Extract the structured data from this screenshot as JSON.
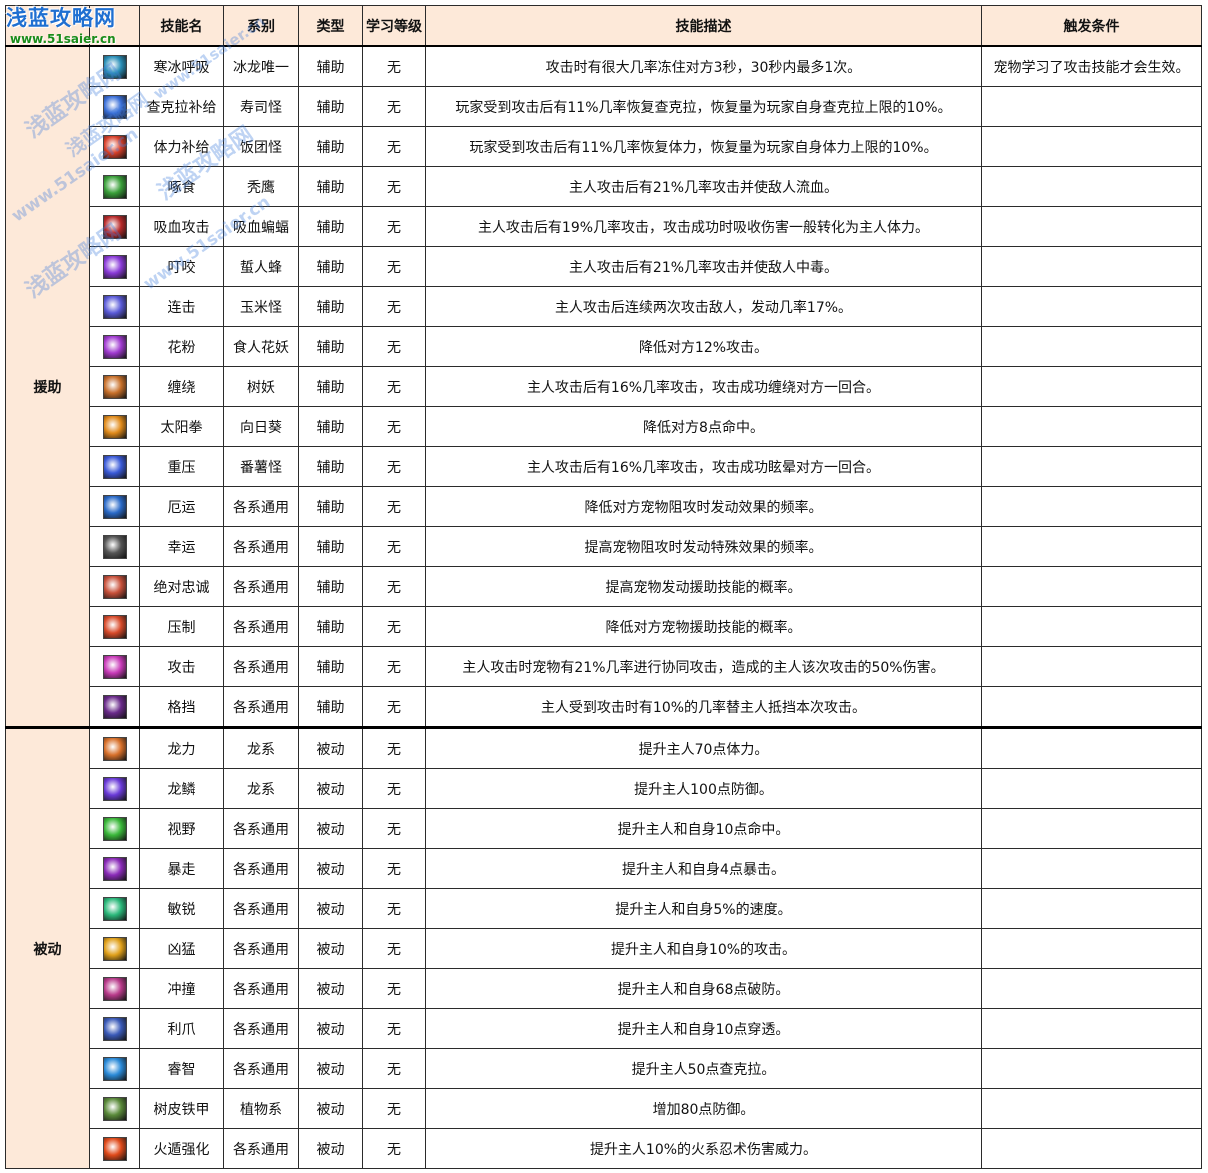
{
  "logo": {
    "line1": "浅蓝攻略网",
    "line2": "www.51saier.cn"
  },
  "watermarks": [
    "浅蓝攻略网",
    "www.51saier.cn",
    "浅蓝攻略网",
    "www.51saier.cn",
    "浅蓝攻略网",
    "www.51saier.cn",
    "浅蓝攻略网"
  ],
  "headers": {
    "icon": "",
    "name": "技能名",
    "series": "系别",
    "type": "类型",
    "level": "学习等级",
    "desc": "技能描述",
    "trigger": "触发条件"
  },
  "groups": [
    {
      "category": "援助",
      "rows": [
        {
          "icon": "ice-breath-icon",
          "color": "#2a8fb8",
          "name": "寒冰呼吸",
          "series": "冰龙唯一",
          "type": "辅助",
          "level": "无",
          "desc": "攻击时有很大几率冻住对方3秒，30秒内最多1次。",
          "trigger": "宠物学习了攻击技能才会生效。"
        },
        {
          "icon": "chakra-supply-icon",
          "color": "#3a6fd8",
          "name": "查克拉补给",
          "series": "寿司怪",
          "type": "辅助",
          "level": "无",
          "desc": "玩家受到攻击后有11%几率恢复查克拉，恢复量为玩家自身查克拉上限的10%。",
          "trigger": ""
        },
        {
          "icon": "stamina-supply-icon",
          "color": "#d8402a",
          "name": "体力补给",
          "series": "饭团怪",
          "type": "辅助",
          "level": "无",
          "desc": "玩家受到攻击后有11%几率恢复体力，恢复量为玩家自身体力上限的10%。",
          "trigger": ""
        },
        {
          "icon": "peck-icon",
          "color": "#3aa03a",
          "name": "啄食",
          "series": "秃鹰",
          "type": "辅助",
          "level": "无",
          "desc": "主人攻击后有21%几率攻击并使敌人流血。",
          "trigger": ""
        },
        {
          "icon": "vampire-attack-icon",
          "color": "#b82a2a",
          "name": "吸血攻击",
          "series": "吸血蝙蝠",
          "type": "辅助",
          "level": "无",
          "desc": "主人攻击后有19%几率攻击，攻击成功时吸收伤害一般转化为主人体力。",
          "trigger": ""
        },
        {
          "icon": "sting-icon",
          "color": "#8a3ad8",
          "name": "叮咬",
          "series": "蜇人蜂",
          "type": "辅助",
          "level": "无",
          "desc": "主人攻击后有21%几率攻击并使敌人中毒。",
          "trigger": ""
        },
        {
          "icon": "combo-icon",
          "color": "#5a5ad8",
          "name": "连击",
          "series": "玉米怪",
          "type": "辅助",
          "level": "无",
          "desc": "主人攻击后连续两次攻击敌人，发动几率17%。",
          "trigger": ""
        },
        {
          "icon": "pollen-icon",
          "color": "#a03ad0",
          "name": "花粉",
          "series": "食人花妖",
          "type": "辅助",
          "level": "无",
          "desc": "降低对方12%攻击。",
          "trigger": ""
        },
        {
          "icon": "entangle-icon",
          "color": "#c8702a",
          "name": "缠绕",
          "series": "树妖",
          "type": "辅助",
          "level": "无",
          "desc": "主人攻击后有16%几率攻击，攻击成功缠绕对方一回合。",
          "trigger": ""
        },
        {
          "icon": "sun-fist-icon",
          "color": "#e08a1a",
          "name": "太阳拳",
          "series": "向日葵",
          "type": "辅助",
          "level": "无",
          "desc": "降低对方8点命中。",
          "trigger": ""
        },
        {
          "icon": "heavy-press-icon",
          "color": "#3a5ad8",
          "name": "重压",
          "series": "番薯怪",
          "type": "辅助",
          "level": "无",
          "desc": "主人攻击后有16%几率攻击，攻击成功眩晕对方一回合。",
          "trigger": ""
        },
        {
          "icon": "bad-luck-icon",
          "color": "#2a6ac8",
          "name": "厄运",
          "series": "各系通用",
          "type": "辅助",
          "level": "无",
          "desc": "降低对方宠物阻攻时发动效果的频率。",
          "trigger": ""
        },
        {
          "icon": "lucky-clover-icon",
          "color": "#555555",
          "name": "幸运",
          "series": "各系通用",
          "type": "辅助",
          "level": "无",
          "desc": "提高宠物阻攻时发动特殊效果的频率。",
          "trigger": ""
        },
        {
          "icon": "absolute-loyalty-icon",
          "color": "#c8503a",
          "name": "绝对忠诚",
          "series": "各系通用",
          "type": "辅助",
          "level": "无",
          "desc": "提高宠物发动援助技能的概率。",
          "trigger": ""
        },
        {
          "icon": "suppress-icon",
          "color": "#d84a2a",
          "name": "压制",
          "series": "各系通用",
          "type": "辅助",
          "level": "无",
          "desc": "降低对方宠物援助技能的概率。",
          "trigger": ""
        },
        {
          "icon": "attack-slash-icon",
          "color": "#c83ab8",
          "name": "攻击",
          "series": "各系通用",
          "type": "辅助",
          "level": "无",
          "desc": "主人攻击时宠物有21%几率进行协同攻击，造成的主人该次攻击的50%伤害。",
          "trigger": ""
        },
        {
          "icon": "block-shield-icon",
          "color": "#6a2a8a",
          "name": "格挡",
          "series": "各系通用",
          "type": "辅助",
          "level": "无",
          "desc": "主人受到攻击时有10%的几率替主人抵挡本次攻击。",
          "trigger": ""
        }
      ]
    },
    {
      "category": "被动",
      "rows": [
        {
          "icon": "dragon-power-icon",
          "color": "#d8702a",
          "name": "龙力",
          "series": "龙系",
          "type": "被动",
          "level": "无",
          "desc": "提升主人70点体力。",
          "trigger": ""
        },
        {
          "icon": "dragon-scale-icon",
          "color": "#6a3ad8",
          "name": "龙鳞",
          "series": "龙系",
          "type": "被动",
          "level": "无",
          "desc": "提升主人100点防御。",
          "trigger": ""
        },
        {
          "icon": "vision-icon",
          "color": "#3ab83a",
          "name": "视野",
          "series": "各系通用",
          "type": "被动",
          "level": "无",
          "desc": "提升主人和自身10点命中。",
          "trigger": ""
        },
        {
          "icon": "rampage-icon",
          "color": "#8a2ab8",
          "name": "暴走",
          "series": "各系通用",
          "type": "被动",
          "level": "无",
          "desc": "提升主人和自身4点暴击。",
          "trigger": ""
        },
        {
          "icon": "keen-icon",
          "color": "#2ab87a",
          "name": "敏锐",
          "series": "各系通用",
          "type": "被动",
          "level": "无",
          "desc": "提升主人和自身5%的速度。",
          "trigger": ""
        },
        {
          "icon": "ferocity-icon",
          "color": "#e0a01a",
          "name": "凶猛",
          "series": "各系通用",
          "type": "被动",
          "level": "无",
          "desc": "提升主人和自身10%的攻击。",
          "trigger": ""
        },
        {
          "icon": "charge-icon",
          "color": "#b83a8a",
          "name": "冲撞",
          "series": "各系通用",
          "type": "被动",
          "level": "无",
          "desc": "提升主人和自身68点破防。",
          "trigger": ""
        },
        {
          "icon": "sharp-claw-icon",
          "color": "#3a5ab8",
          "name": "利爪",
          "series": "各系通用",
          "type": "被动",
          "level": "无",
          "desc": "提升主人和自身10点穿透。",
          "trigger": ""
        },
        {
          "icon": "wisdom-icon",
          "color": "#2a8ad8",
          "name": "睿智",
          "series": "各系通用",
          "type": "被动",
          "level": "无",
          "desc": "提升主人50点查克拉。",
          "trigger": ""
        },
        {
          "icon": "bark-armor-icon",
          "color": "#5a8a3a",
          "name": "树皮铁甲",
          "series": "植物系",
          "type": "被动",
          "level": "无",
          "desc": "增加80点防御。",
          "trigger": ""
        },
        {
          "icon": "fire-escape-boost-icon",
          "color": "#e04a1a",
          "name": "火遁强化",
          "series": "各系通用",
          "type": "被动",
          "level": "无",
          "desc": "提升主人10%的火系忍术伤害威力。",
          "trigger": ""
        }
      ]
    }
  ]
}
